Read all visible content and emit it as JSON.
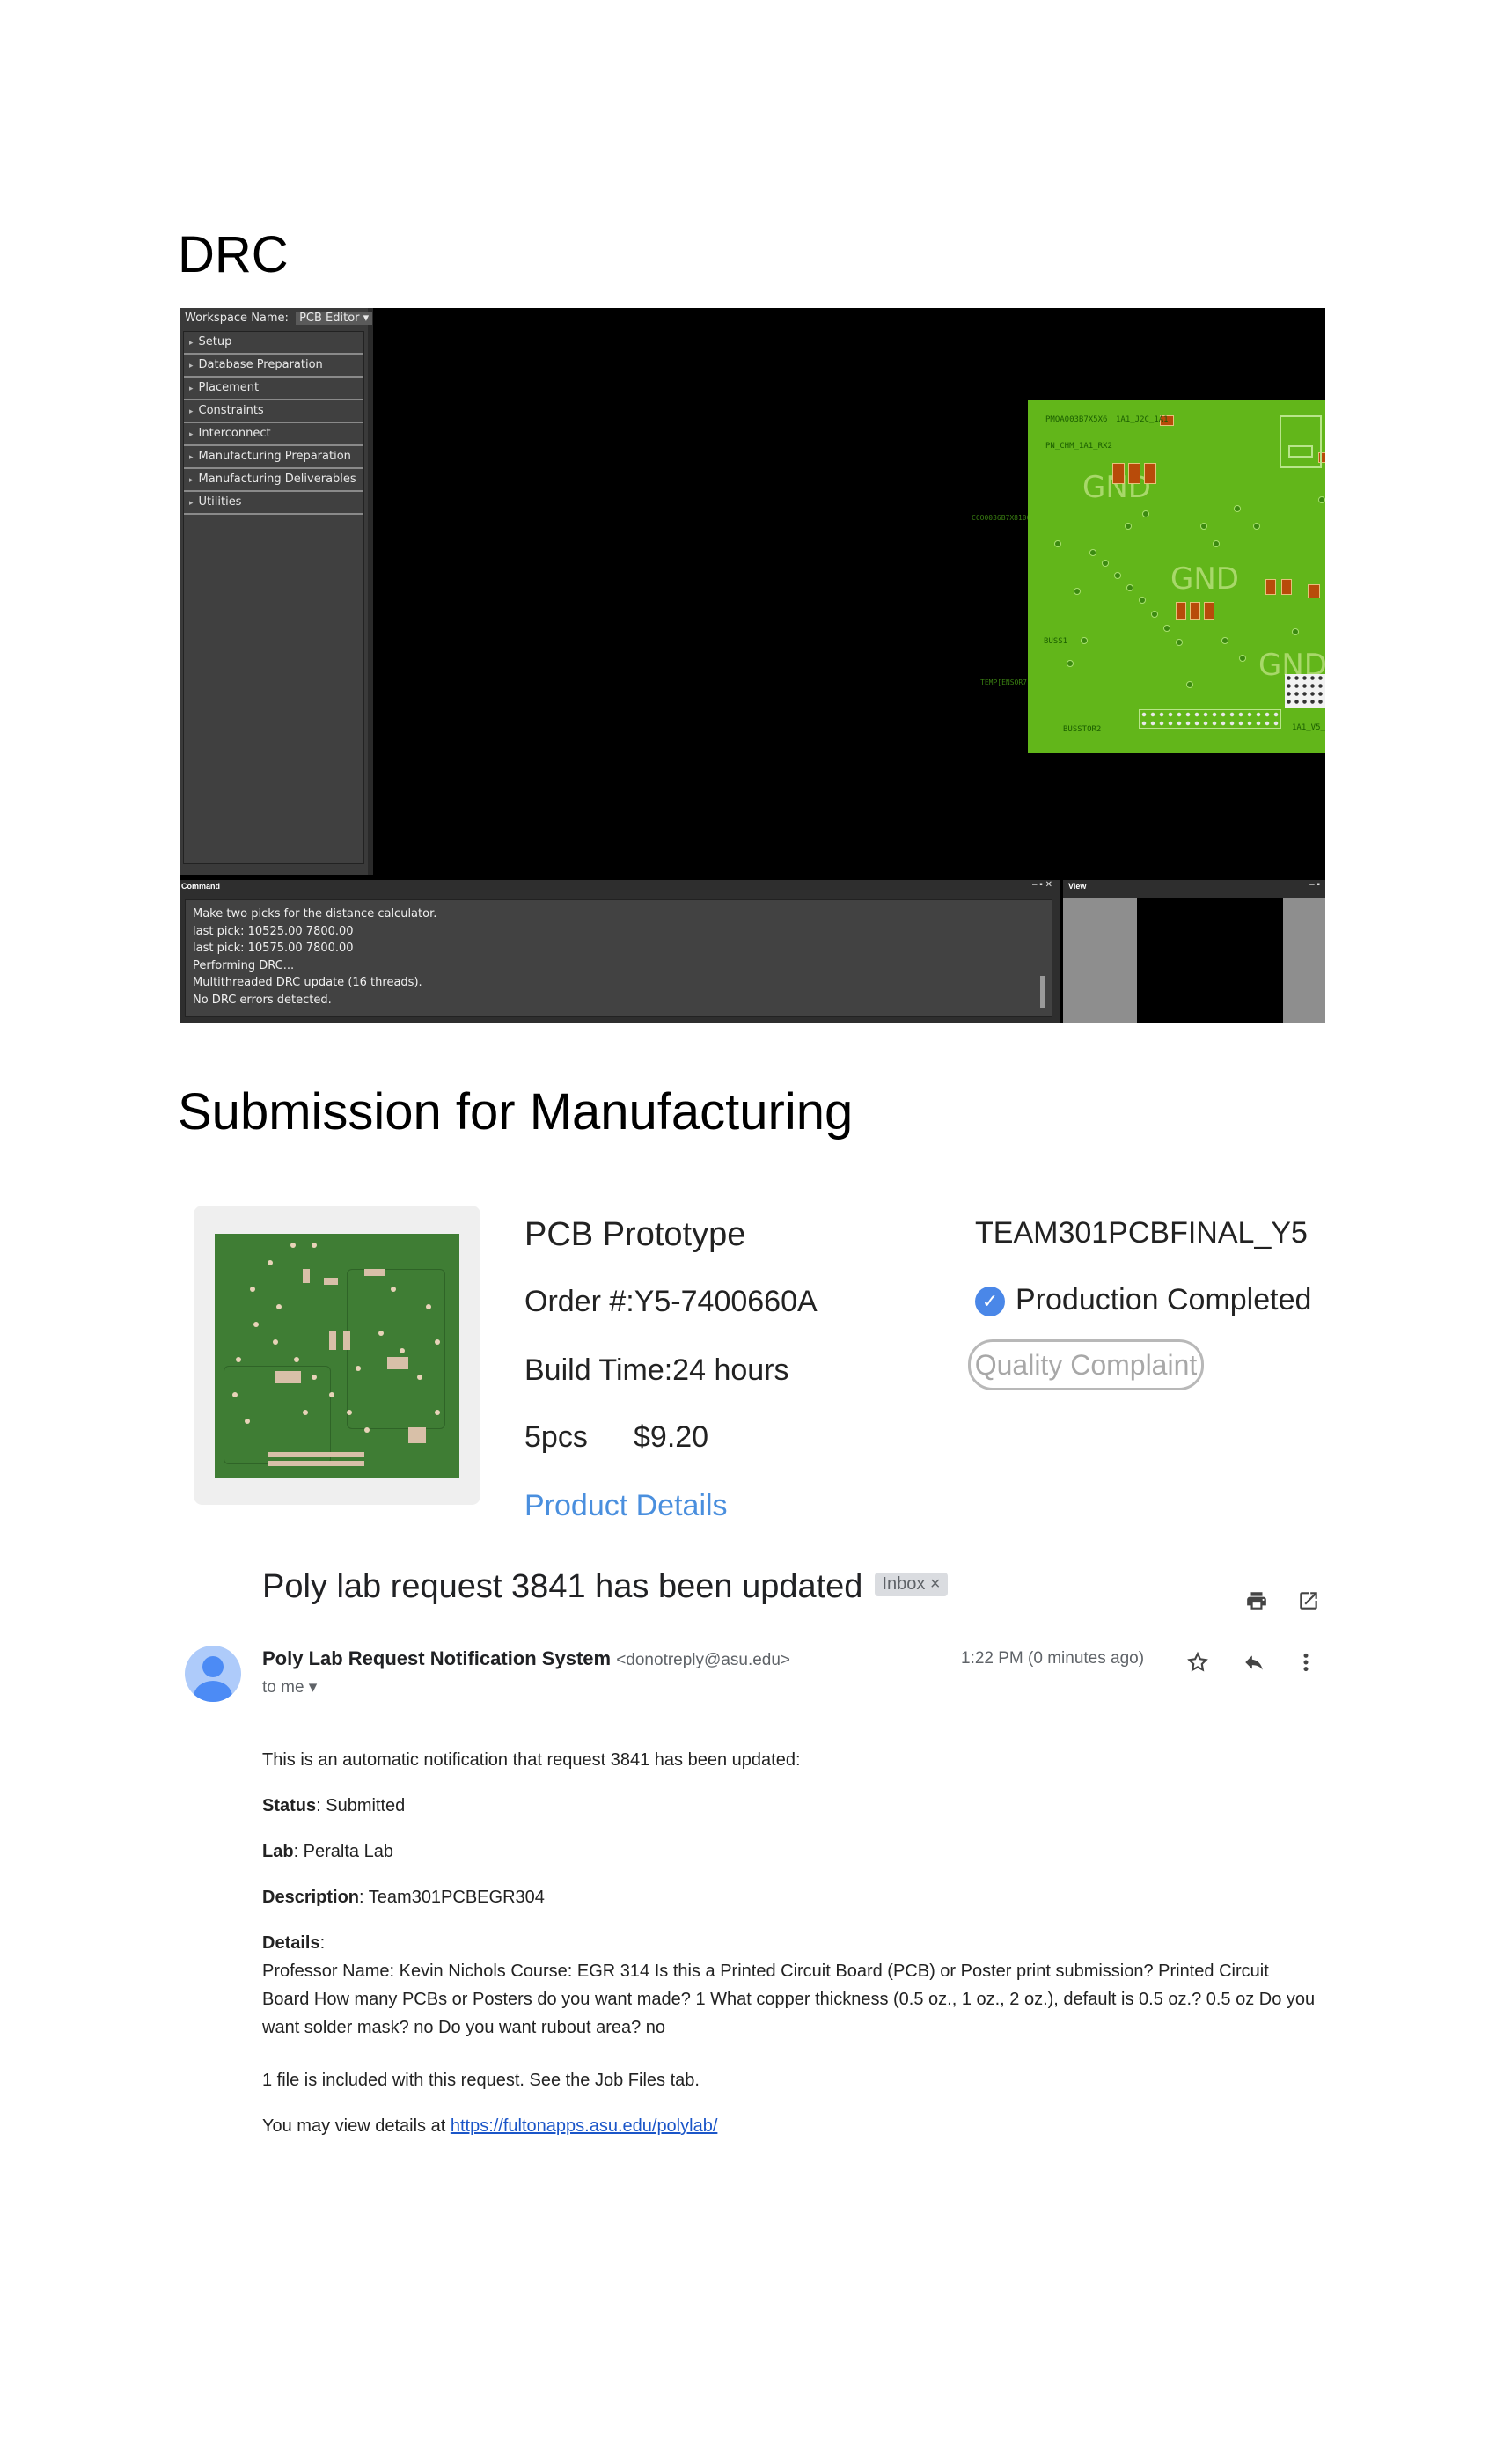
{
  "drc_section": {
    "heading": "DRC",
    "workspace_label": "Workspace Name:",
    "workspace_value": "PCB Editor",
    "workspace_items": [
      "Setup",
      "Database Preparation",
      "Placement",
      "Constraints",
      "Interconnect",
      "Manufacturing Preparation",
      "Manufacturing Deliverables",
      "Utilities"
    ],
    "board_gnd_labels": [
      "GND",
      "GND",
      "GND"
    ],
    "command_title": "Command",
    "command_lines": [
      "Make two picks for the distance calculator.",
      "last pick:  10525.00 7800.00",
      "last pick:  10575.00 7800.00",
      "Performing DRC...",
      "Multithreaded DRC update (16 threads).",
      "No DRC errors detected."
    ],
    "view_title": "View",
    "panel_controls": "– ▪ ✕"
  },
  "manufacturing": {
    "heading": "Submission for Manufacturing",
    "product": "PCB Prototype",
    "order": "Order #:Y5-7400660A",
    "build_time": "Build Time:24 hours",
    "quantity": "5pcs",
    "price": "$9.20",
    "details_link": "Product Details",
    "file_name": "TEAM301PCBFINAL_Y5",
    "status": "Production Completed",
    "complaint_button": "Quality Complaint",
    "accent_color": "#4a87e8"
  },
  "email": {
    "subject": "Poly lab request 3841 has been updated",
    "label_chip": "Inbox ×",
    "sender_name": "Poly Lab Request Notification System",
    "sender_address": "<donotreply@asu.edu>",
    "recipient": "to me ▾",
    "time": "1:22 PM (0 minutes ago)",
    "intro": "This is an automatic notification that request 3841 has been updated:",
    "status_label": "Status",
    "status_value": ": Submitted",
    "lab_label": "Lab",
    "lab_value": ": Peralta Lab",
    "description_label": "Description",
    "description_value": ": Team301PCBEGR304",
    "details_label": "Details",
    "details_colon": ":",
    "details_value": "Professor Name: Kevin Nichols Course: EGR 314 Is this a Printed Circuit Board (PCB) or Poster print submission? Printed Circuit Board How many PCBs or Posters do you want made? 1 What copper thickness (0.5 oz., 1 oz., 2 oz.), default is 0.5 oz.? 0.5 oz Do you want solder mask? no Do you want rubout area? no",
    "files_note": "1 file is included with this request. See the Job Files tab.",
    "view_prefix": "You may view details at ",
    "view_link": "https://fultonapps.asu.edu/polylab/",
    "icons": [
      "print-icon",
      "open-in-new-icon",
      "star-icon",
      "reply-icon",
      "more-vert-icon"
    ]
  }
}
